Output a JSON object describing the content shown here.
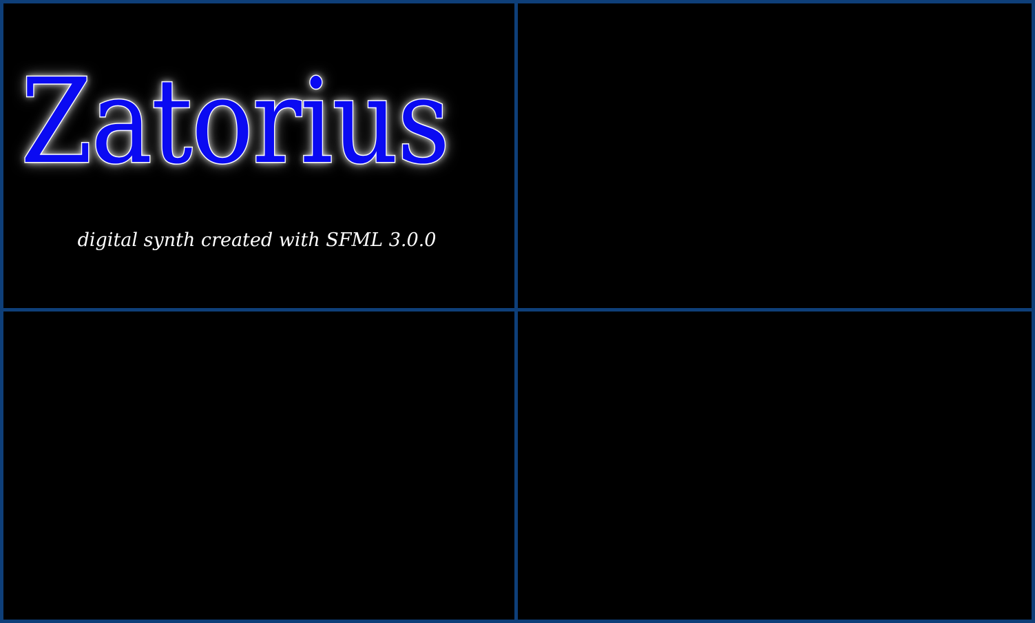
{
  "app": {
    "title": "Zatorius",
    "subtitle": "digital synth created with SFML 3.0.0"
  },
  "colors": {
    "background": "#000000",
    "panel_border": "#0e3f79",
    "title_fill": "#0a0af2",
    "title_outline": "#ffffff",
    "subtitle": "#ffffff"
  }
}
